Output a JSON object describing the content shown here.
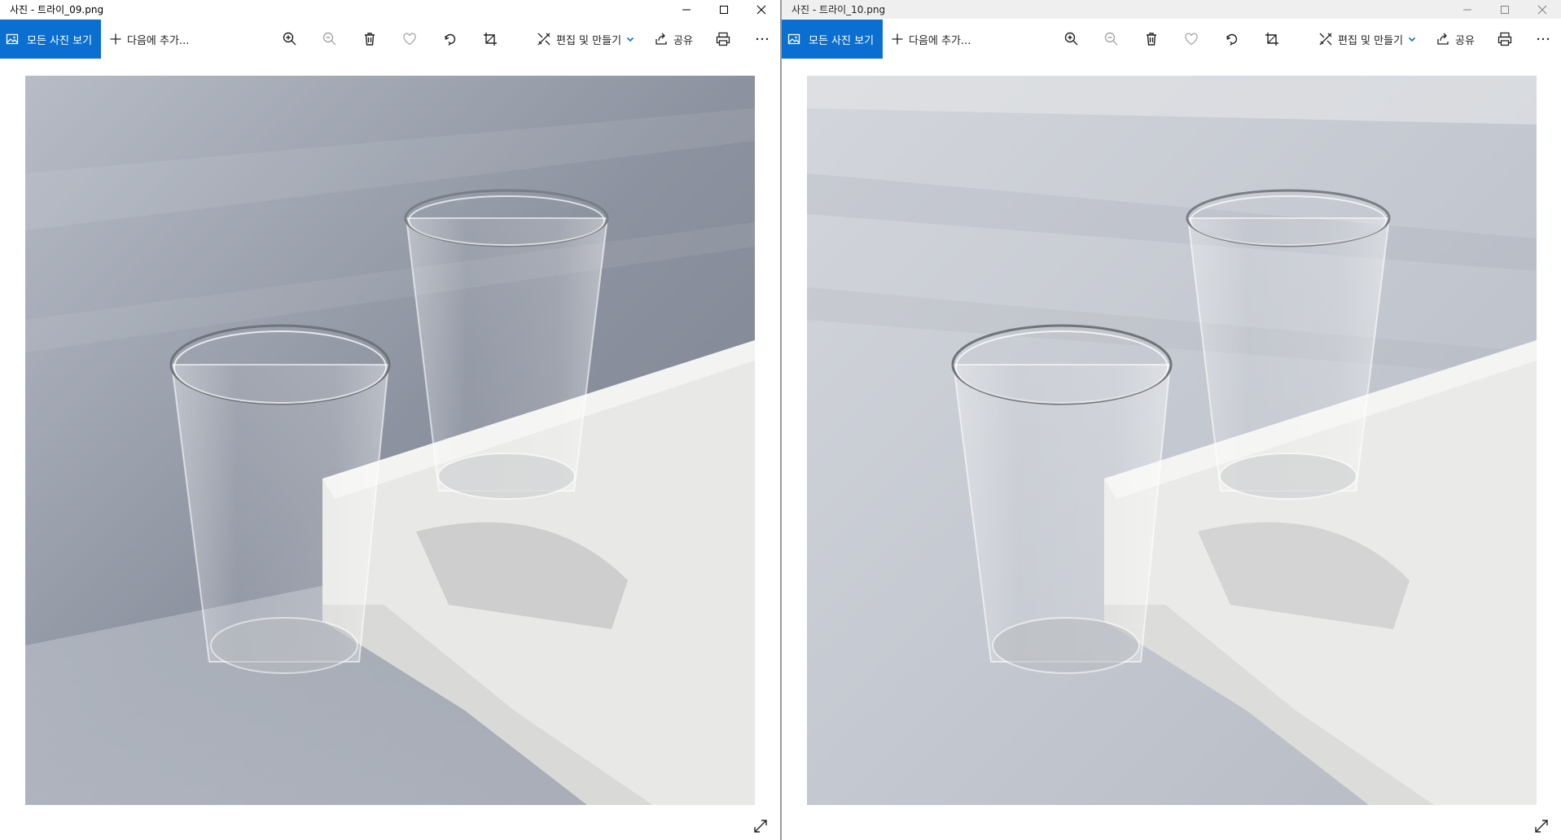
{
  "windows": [
    {
      "title": "사진 - 트라이_09.png",
      "toolbar": {
        "all_photos_label": "모든 사진 보기",
        "add_to_label": "다음에 추가...",
        "edit_create_label": "편집 및 만들기",
        "share_label": "공유"
      },
      "photo_tone": "dark"
    },
    {
      "title": "사진 - 트라이_10.png",
      "toolbar": {
        "all_photos_label": "모든 사진 보기",
        "add_to_label": "다음에 추가...",
        "edit_create_label": "편집 및 만들기",
        "share_label": "공유"
      },
      "photo_tone": "light"
    }
  ],
  "colors": {
    "accent": "#0b6fd1",
    "photo_bg_dark": "#8d93a0",
    "photo_bg_light": "#c5c9d2",
    "counter": "#e6e6e4"
  },
  "icons": [
    "photos-icon",
    "plus-icon",
    "zoom-in-icon",
    "zoom-out-icon",
    "delete-icon",
    "favorite-icon",
    "rotate-icon",
    "crop-icon",
    "edit-icon",
    "chevron-down-icon",
    "share-icon",
    "print-icon",
    "more-icon",
    "fullscreen-icon",
    "minimize-icon",
    "maximize-icon",
    "close-icon"
  ]
}
